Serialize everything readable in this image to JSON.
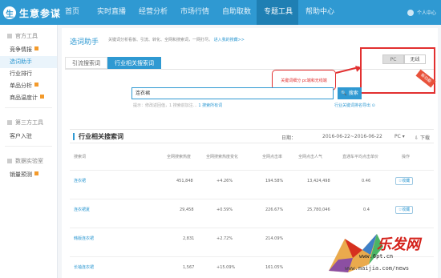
{
  "app": {
    "logo_glyph": "生",
    "name": "生意参谋"
  },
  "nav": [
    "首页",
    "实时直播",
    "经营分析",
    "市场行情",
    "自助取数",
    "专题工具",
    "帮助中心"
  ],
  "nav_active_index": 5,
  "user": {
    "label": "个人中心"
  },
  "sidebar": {
    "groups": [
      {
        "title": "官方工具",
        "items": [
          {
            "label": "竞争情报",
            "badge": true
          },
          {
            "label": "选词助手",
            "badge": false,
            "active": true
          },
          {
            "label": "行业排行",
            "badge": false
          },
          {
            "label": "单品分析",
            "badge": true
          },
          {
            "label": "商品温度计",
            "badge": true
          }
        ]
      },
      {
        "title": "第三方工具",
        "items": [
          {
            "label": "客户入驻",
            "badge": false
          }
        ]
      },
      {
        "title": "数据实验室",
        "items": [
          {
            "label": "销量预测",
            "badge": true
          }
        ]
      }
    ]
  },
  "tool": {
    "title": "选词助手",
    "desc": "关键词分析看板、引流、转化、全网和搜索词，一网打尽。",
    "desc_link": "进入我的搜藏>>"
  },
  "tabs": [
    "引流搜索词",
    "行业相关搜索词"
  ],
  "active_tab": 1,
  "device_toggle": {
    "pc": "PC",
    "wireless": "无线",
    "active": "pc"
  },
  "ribbon": "新功能",
  "callout": "关键词细分 pc端和无线端",
  "search": {
    "value": "连衣裙",
    "button": "搜索",
    "hint": "提示：修改返回值，1 搜索前加注…",
    "hint_link": "1 搜索所有词",
    "export": "行业关键词排名导出"
  },
  "results": {
    "title": "行业相关搜索词",
    "date_label": "日期：",
    "date_range": "2016-06-22~2016-06-22",
    "device": "PC",
    "download": "下载"
  },
  "table": {
    "headers": [
      "搜索词",
      "全网搜索热度",
      "全网搜索热度变化",
      "全网点击率",
      "全网点击人气",
      "直通车平均点击单价",
      "操作"
    ],
    "rows": [
      {
        "keyword": "连衣裙",
        "heat": "451,848",
        "heat_change": "+4.26%",
        "ctr": "194.58%",
        "click_pop": "13,424,498",
        "cpc": "0.46",
        "action": "收藏"
      },
      {
        "keyword": "连衣裙夏",
        "heat": "29,458",
        "heat_change": "+0.59%",
        "ctr": "226.67%",
        "click_pop": "25,780,046",
        "cpc": "0.4",
        "action": "收藏"
      },
      {
        "keyword": "韩版连衣裙",
        "heat": "2,831",
        "heat_change": "+2.72%",
        "ctr": "214.09%",
        "click_pop": "",
        "cpc": "",
        "action": "收藏"
      },
      {
        "keyword": "长袖连衣裙",
        "heat": "1,567",
        "heat_change": "+15.09%",
        "ctr": "161.05%",
        "click_pop": "",
        "cpc": "",
        "action": "收藏"
      }
    ]
  },
  "watermark": {
    "brand": "乐发网",
    "url": "www.6pt.cn",
    "site": "www.maijia.com/news"
  },
  "colors": {
    "primary": "#2f99d2",
    "annotation": "#e23030",
    "badge": "#f39a2b",
    "ribbon": "#e8523b"
  }
}
